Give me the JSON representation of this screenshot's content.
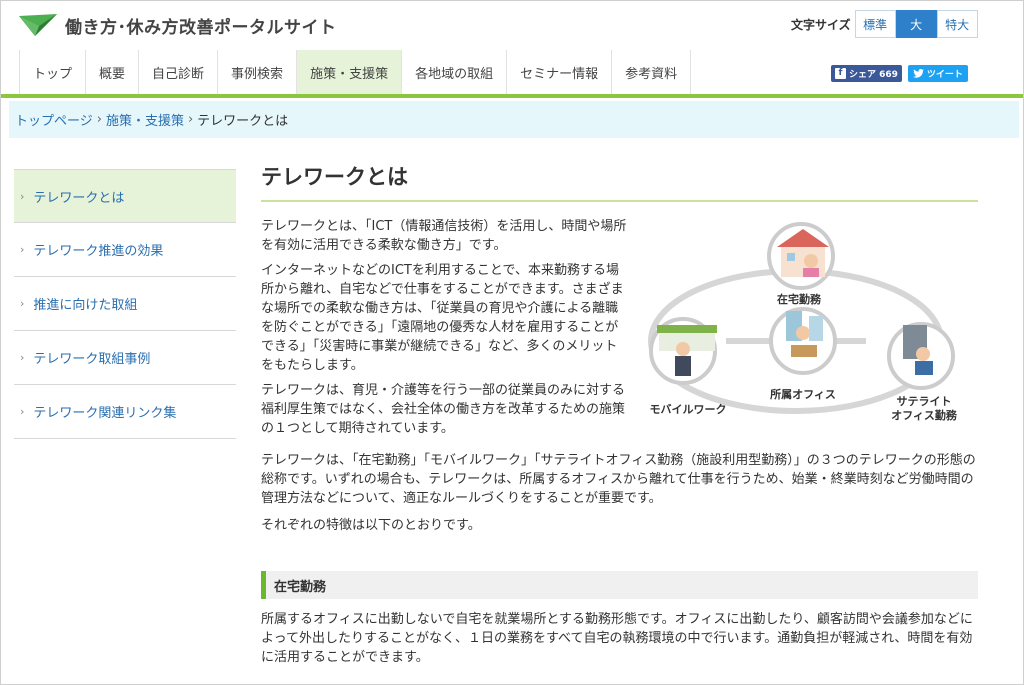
{
  "header": {
    "site_title": "働き方･休み方改善ポータルサイト",
    "font_size_label": "文字サイズ",
    "font_sizes": [
      "標準",
      "大",
      "特大"
    ],
    "font_size_selected": "大"
  },
  "nav": {
    "items": [
      "トップ",
      "概要",
      "自己診断",
      "事例検索",
      "施策・支援策",
      "各地域の取組",
      "セミナー情報",
      "参考資料"
    ],
    "active": "施策・支援策"
  },
  "social": {
    "facebook_label": "シェア 669",
    "twitter_label": "ツイート"
  },
  "breadcrumb": {
    "items": [
      "トップページ",
      "施策・支援策"
    ],
    "current": "テレワークとは",
    "separator": "›"
  },
  "sidebar": {
    "items": [
      "テレワークとは",
      "テレワーク推進の効果",
      "推進に向けた取組",
      "テレワーク取組事例",
      "テレワーク関連リンク集"
    ],
    "active": "テレワークとは"
  },
  "main": {
    "title": "テレワークとは",
    "intro_paragraphs": [
      "テレワークとは、「ICT（情報通信技術）を活用し、時間や場所を有効に活用できる柔軟な働き方」です。",
      "インターネットなどのICTを利用することで、本来勤務する場所から離れ、自宅などで仕事をすることができます。さまざまな場所での柔軟な働き方は、「従業員の育児や介護による離職を防ぐことができる」「遠隔地の優秀な人材を雇用することができる」「災害時に事業が継続できる」など、多くのメリットをもたらします。",
      "テレワークは、育児・介護等を行う一部の従業員のみに対する福利厚生策ではなく、会社全体の働き方を改革するための施策の１つとして期待されています。"
    ],
    "full_paragraphs": [
      "テレワークは、「在宅勤務」「モバイルワーク」「サテライトオフィス勤務（施設利用型勤務）」の３つのテレワークの形態の総称です。いずれの場合も、テレワークは、所属するオフィスから離れて仕事を行うため、始業・終業時刻など労働時間の管理方法などについて、適正なルールづくりをすることが重要です。",
      "それぞれの特徴は以下のとおりです。"
    ],
    "diagram": {
      "home_label": "在宅勤務",
      "office_label": "所属オフィス",
      "mobile_label": "モバイルワーク",
      "satellite_label_1": "サテライト",
      "satellite_label_2": "オフィス勤務"
    },
    "section": {
      "heading": "在宅勤務",
      "body": "所属するオフィスに出勤しないで自宅を就業場所とする勤務形態です。オフィスに出勤したり、顧客訪問や会議参加などによって外出したりすることがなく、１日の業務をすべて自宅の執務環境の中で行います。通勤負担が軽減され、時間を有効に活用することができます。"
    }
  },
  "colors": {
    "accent_green": "#8cc63f",
    "link_blue": "#2a6fb0",
    "active_bg": "#e6f3d9",
    "breadcrumb_bg": "#e6f7fb"
  }
}
